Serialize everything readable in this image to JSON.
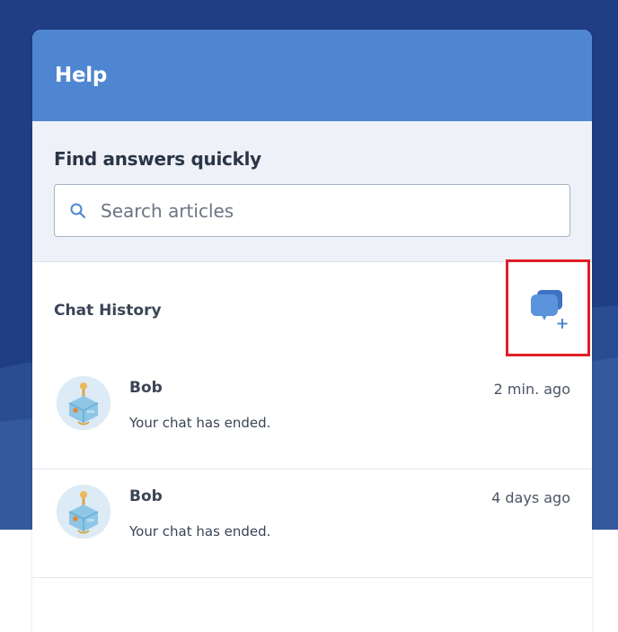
{
  "colors": {
    "background_dark": "#1f3e83",
    "header_blue": "#4f86d2",
    "search_section_bg": "#eef2f8",
    "highlight_red": "#e01e24",
    "icon_blue": "#4f86d2"
  },
  "header": {
    "title": "Help"
  },
  "search": {
    "heading": "Find answers quickly",
    "placeholder": "Search articles",
    "icon": "search-icon"
  },
  "history": {
    "title": "Chat History",
    "new_chat_icon": "new-chat-icon",
    "chats": [
      {
        "name": "Bob",
        "time": "2 min. ago",
        "message": "Your chat has ended."
      },
      {
        "name": "Bob",
        "time": "4 days ago",
        "message": "Your chat has ended."
      }
    ]
  }
}
